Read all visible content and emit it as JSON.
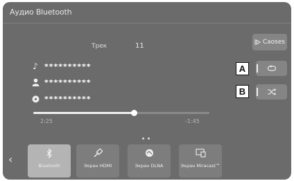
{
  "header": {
    "title": "Аудио Bluetooth"
  },
  "source_button": {
    "label": "Caoses"
  },
  "track": {
    "label": "Трек",
    "number": "11"
  },
  "metadata": {
    "rows": [
      {
        "icon": "music-note-icon",
        "value": "**********"
      },
      {
        "icon": "artist-icon",
        "value": "**********"
      },
      {
        "icon": "album-icon",
        "value": "**********"
      }
    ]
  },
  "progress": {
    "elapsed": "2:25",
    "remaining": "-1:45",
    "fraction": 0.57
  },
  "controls": {
    "repeat_icon": "repeat-icon",
    "shuffle_icon": "shuffle-icon",
    "callout_a": "A",
    "callout_b": "B"
  },
  "apps": [
    {
      "icon": "bluetooth-icon",
      "label": "Bluetooth",
      "active": true
    },
    {
      "icon": "usb-cable-icon",
      "label": "Экран HDMI",
      "active": false
    },
    {
      "icon": "dlna-icon",
      "label": "Экран DLNA",
      "active": false
    },
    {
      "icon": "miracast-icon",
      "label": "Экран Miracast™",
      "active": false
    }
  ],
  "colors": {
    "screen": "#6b6b6b",
    "button": "#858585",
    "active_app": "#b4b4b4"
  }
}
